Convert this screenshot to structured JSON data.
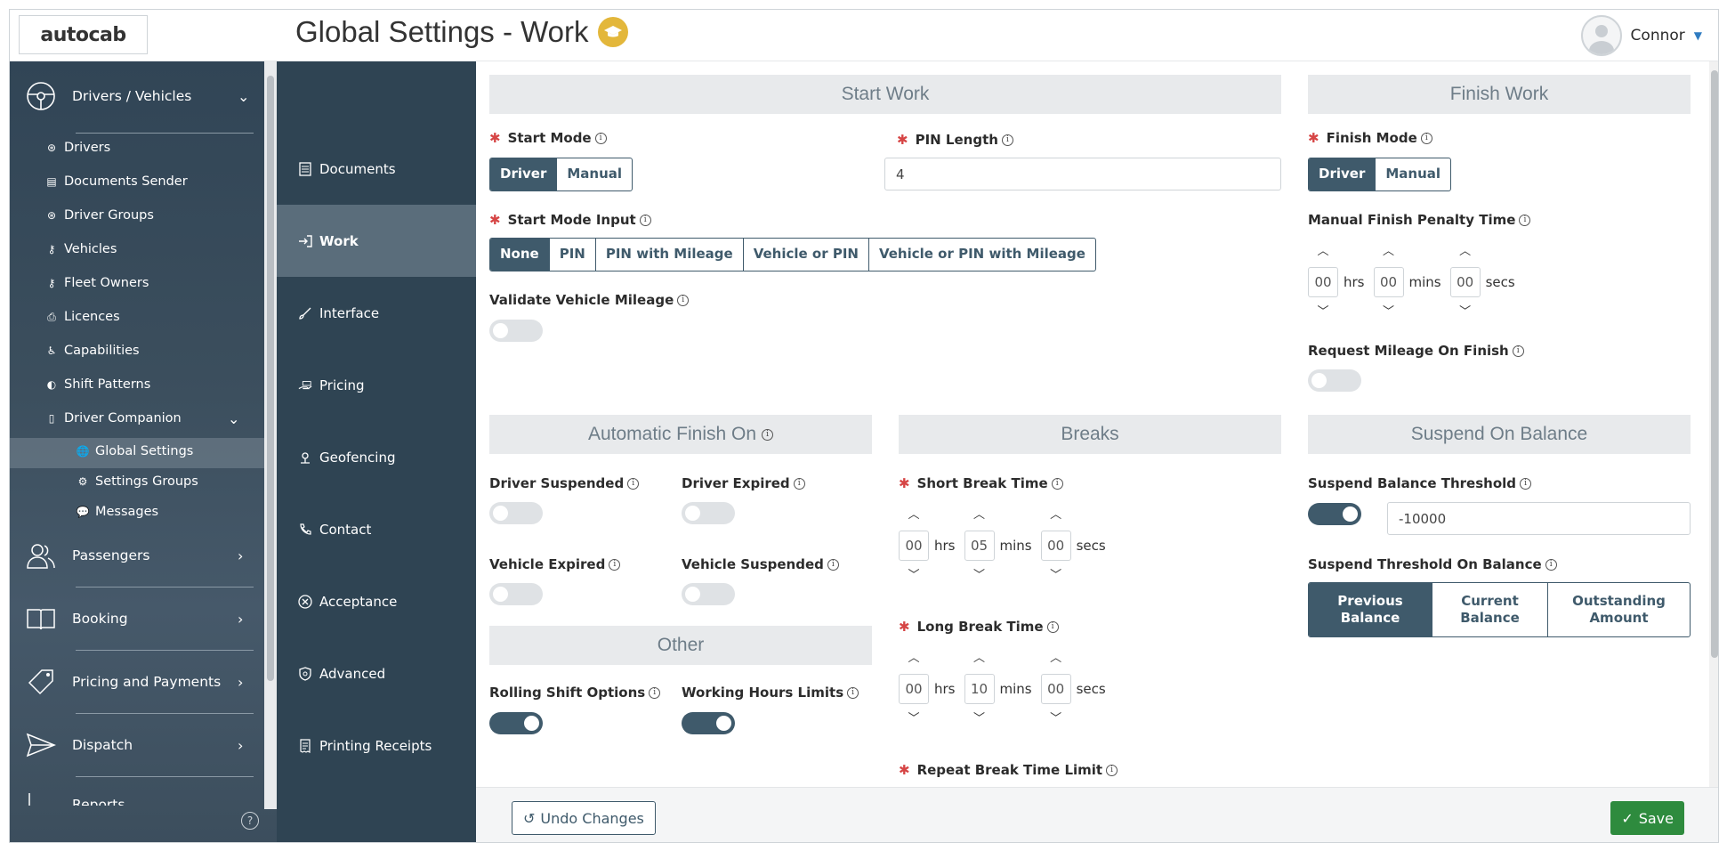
{
  "header": {
    "logo": "autocab",
    "title": "Global Settings - Work",
    "user": "Connor"
  },
  "sidebar": {
    "groups": [
      {
        "label": "Drivers / Vehicles",
        "icon": "steering-wheel-icon"
      },
      {
        "label": "Passengers",
        "icon": "people-icon"
      },
      {
        "label": "Booking",
        "icon": "book-icon"
      },
      {
        "label": "Pricing and Payments",
        "icon": "tag-icon"
      },
      {
        "label": "Dispatch",
        "icon": "send-icon"
      },
      {
        "label": "Reports",
        "icon": "chart-icon"
      }
    ],
    "items": [
      {
        "label": "Drivers"
      },
      {
        "label": "Documents Sender"
      },
      {
        "label": "Driver Groups"
      },
      {
        "label": "Vehicles"
      },
      {
        "label": "Fleet Owners"
      },
      {
        "label": "Licences"
      },
      {
        "label": "Capabilities"
      },
      {
        "label": "Shift Patterns"
      },
      {
        "label": "Driver Companion"
      }
    ],
    "sub_items": [
      {
        "label": "Global Settings"
      },
      {
        "label": "Settings Groups"
      },
      {
        "label": "Messages"
      }
    ]
  },
  "subnav": [
    {
      "label": "Documents"
    },
    {
      "label": "Work"
    },
    {
      "label": "Interface"
    },
    {
      "label": "Pricing"
    },
    {
      "label": "Geofencing"
    },
    {
      "label": "Contact"
    },
    {
      "label": "Acceptance"
    },
    {
      "label": "Advanced"
    },
    {
      "label": "Printing Receipts"
    }
  ],
  "start_work": {
    "header": "Start Work",
    "start_mode": {
      "label": "Start Mode",
      "options": [
        "Driver",
        "Manual"
      ],
      "selected": "Driver"
    },
    "pin_length": {
      "label": "PIN Length",
      "value": "4"
    },
    "start_mode_input": {
      "label": "Start Mode Input",
      "options": [
        "None",
        "PIN",
        "PIN with Mileage",
        "Vehicle or PIN",
        "Vehicle or PIN with Mileage"
      ],
      "selected": "None"
    },
    "validate_mileage": {
      "label": "Validate Vehicle Mileage",
      "on": false
    }
  },
  "finish_work": {
    "header": "Finish Work",
    "finish_mode": {
      "label": "Finish Mode",
      "options": [
        "Driver",
        "Manual"
      ],
      "selected": "Driver"
    },
    "penalty": {
      "label": "Manual Finish Penalty Time",
      "hrs": "00",
      "mins": "00",
      "secs": "00"
    },
    "request_mileage": {
      "label": "Request Mileage On Finish",
      "on": false
    }
  },
  "auto_finish": {
    "header": "Automatic Finish On",
    "driver_suspended": "Driver Suspended",
    "driver_expired": "Driver Expired",
    "vehicle_expired": "Vehicle Expired",
    "vehicle_suspended": "Vehicle Suspended"
  },
  "other": {
    "header": "Other",
    "rolling": "Rolling Shift Options",
    "working_hours": "Working Hours Limits"
  },
  "breaks": {
    "header": "Breaks",
    "short": {
      "label": "Short Break Time",
      "hrs": "00",
      "mins": "05",
      "secs": "00"
    },
    "long": {
      "label": "Long Break Time",
      "hrs": "00",
      "mins": "10",
      "secs": "00"
    },
    "repeat": {
      "label": "Repeat Break Time Limit"
    }
  },
  "suspend": {
    "header": "Suspend On Balance",
    "threshold": {
      "label": "Suspend Balance Threshold",
      "value": "-10000",
      "on": true
    },
    "threshold_on": {
      "label": "Suspend Threshold On Balance",
      "options": [
        "Previous Balance",
        "Current Balance",
        "Outstanding Amount"
      ],
      "selected": "Previous Balance"
    }
  },
  "units": {
    "hrs": "hrs",
    "mins": "mins",
    "secs": "secs"
  },
  "footer": {
    "undo": "Undo Changes",
    "save": "Save"
  },
  "colors": {
    "primary": "#3f5a6b",
    "save": "#2e8b3e",
    "badge": "#e3b73b",
    "required": "#d64545"
  }
}
